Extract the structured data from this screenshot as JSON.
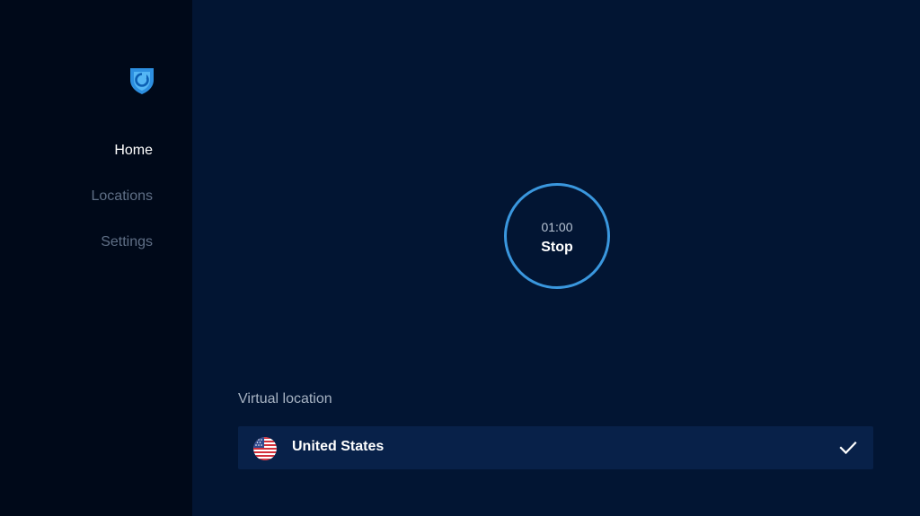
{
  "sidebar": {
    "logo_icon": "shield-logo-icon",
    "items": [
      {
        "label": "Home",
        "active": true
      },
      {
        "label": "Locations",
        "active": false
      },
      {
        "label": "Settings",
        "active": false
      }
    ]
  },
  "main": {
    "timer": {
      "time": "01:00",
      "action": "Stop"
    },
    "virtual_location": {
      "label": "Virtual location",
      "selected": "United States",
      "flag_icon": "us-flag-icon",
      "check_icon": "checkmark-icon"
    }
  },
  "colors": {
    "background": "#021533",
    "sidebar": "#000919",
    "accent": "#3a97de",
    "row": "#082149",
    "muted_text": "#5f6f86"
  }
}
